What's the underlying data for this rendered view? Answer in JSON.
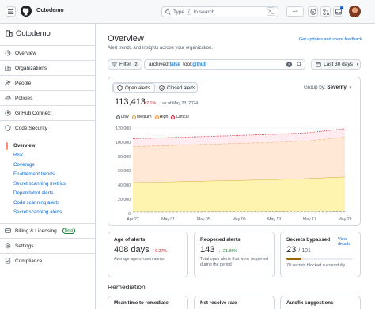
{
  "app": {
    "org_name": "Octodemo",
    "search_placeholder_pre": "Type",
    "search_key": "/",
    "search_placeholder_post": "to search",
    "plus_label": "+"
  },
  "sidebar": {
    "header": "Octodemo",
    "items": [
      {
        "label": "Overview",
        "icon": "overview-icon"
      },
      {
        "label": "Organizations",
        "icon": "organization-icon"
      },
      {
        "label": "People",
        "icon": "people-icon"
      },
      {
        "label": "Policies",
        "icon": "law-icon"
      },
      {
        "label": "GitHub Connect",
        "icon": "github-icon"
      },
      {
        "label": "Code Security",
        "icon": "shield-icon"
      }
    ],
    "sub_items": [
      "Overview",
      "Risk",
      "Coverage",
      "Enablement trends",
      "Secret scanning metrics",
      "Dependabot alerts",
      "Code scanning alerts",
      "Secret scanning alerts"
    ],
    "bottom_items": [
      {
        "label": "Billing & Licensing",
        "icon": "credit-card-icon",
        "badge": "Beta"
      },
      {
        "label": "Settings",
        "icon": "gear-icon"
      },
      {
        "label": "Compliance",
        "icon": "checklist-icon"
      }
    ]
  },
  "main": {
    "title": "Overview",
    "subtitle": "Alert trends and insights across your organization.",
    "updates_link": "Get updates and share feedback",
    "filter": {
      "label": "Filter",
      "count": "2",
      "query_key1": "archived:",
      "query_val1": "false",
      "query_key2": "tool:",
      "query_val2": "github"
    },
    "date_range": "Last 30 days",
    "tabs": [
      "Open alerts",
      "Closed alerts"
    ],
    "group_by_label": "Group by:",
    "group_by_value": "Severity",
    "open_count": "113,413",
    "open_delta": "7.1%",
    "open_delta_note": "as of May 23, 2024"
  },
  "chart_data": {
    "type": "area",
    "stacked": true,
    "x": [
      "Apr 27",
      "May 01",
      "May 05",
      "May 09",
      "May 13",
      "May 17",
      "May 23"
    ],
    "ylim": [
      0,
      120000
    ],
    "yticks": [
      "120,000",
      "100,000",
      "80,000",
      "60,000",
      "40,000",
      "20,000",
      "0"
    ],
    "series": [
      {
        "name": "Low",
        "color": "#57606a",
        "values": [
          2500,
          2500,
          2600,
          2600,
          2700,
          2800,
          3000
        ]
      },
      {
        "name": "Medium",
        "color": "#d4a72c",
        "values": [
          41000,
          42000,
          43000,
          44000,
          45000,
          46500,
          48500
        ]
      },
      {
        "name": "High",
        "color": "#fb8f44",
        "values": [
          50500,
          51000,
          51500,
          52000,
          52500,
          53000,
          56000
        ]
      },
      {
        "name": "Critical",
        "color": "#cf222e",
        "values": [
          11000,
          11000,
          11000,
          11000,
          11000,
          11200,
          11500
        ]
      }
    ],
    "grid": true,
    "legend_position": "top-left"
  },
  "cards": [
    {
      "title": "Age of alerts",
      "value": "408 days",
      "delta": "9.27%",
      "delta_dir": "up",
      "note": "Average age of open alerts"
    },
    {
      "title": "Reopened alerts",
      "value": "143",
      "delta": "-21.86%",
      "delta_dir": "down",
      "note": "Total open alerts that were reopened during the period"
    },
    {
      "title": "Secrets bypassed",
      "value": "23",
      "value_suffix": "/ 101",
      "link": "View details",
      "progress": 0.23,
      "note": "78 secrets blocked successfully"
    }
  ],
  "remediation": {
    "heading": "Remediation",
    "cards": [
      "Mean time to remediate",
      "Net resolve rate",
      "Autofix suggestions"
    ]
  }
}
